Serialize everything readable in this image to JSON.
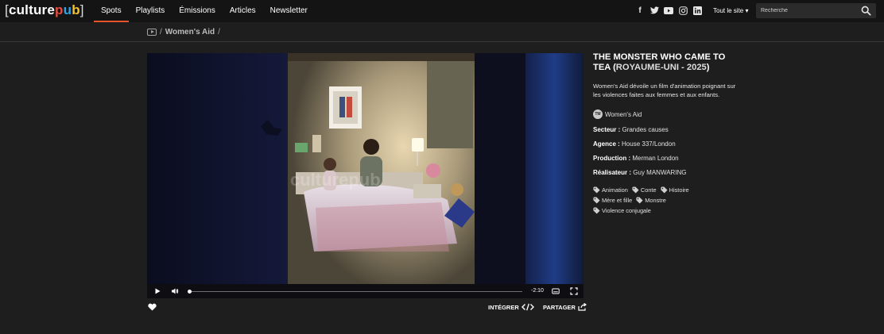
{
  "nav": {
    "logo": {
      "open": "[",
      "culture": "culture",
      "pub_p": "p",
      "pub_u": "u",
      "pub_b": "b",
      "close": "]"
    },
    "items": [
      {
        "label": "Spots",
        "active": true
      },
      {
        "label": "Playlists"
      },
      {
        "label": "Émissions"
      },
      {
        "label": "Articles"
      },
      {
        "label": "Newsletter"
      }
    ],
    "social_icons": [
      "facebook-icon",
      "twitter-icon",
      "youtube-icon",
      "instagram-icon",
      "linkedin-icon"
    ],
    "tout_le_site": "Tout le site ▾",
    "search_placeholder": "Recherche",
    "accent_color": "#e8542a"
  },
  "breadcrumb": {
    "sep1": "/",
    "current": "Women's Aid",
    "sep2": "/"
  },
  "video": {
    "watermark": "culturepub",
    "time": "-2:10",
    "progress": 0.0,
    "controls": [
      "play-icon",
      "volume-icon",
      "subtitles-icon",
      "fullscreen-icon"
    ]
  },
  "actions": {
    "integrer": "INTÉGRER",
    "partager": "PARTAGER"
  },
  "info": {
    "title_main": "THE MONSTER WHO CAME TO TEA (",
    "title_country": "ROYAUME-UNI - 2025",
    "title_close": ")",
    "description": "Women's Aid dévoile un film d'animation poignant sur les violences faites aux femmes et aux enfants.",
    "advertiser": "Women's Aid",
    "advertiser_logo": "TM",
    "secteur_label": "Secteur :",
    "secteur": "Grandes causes",
    "agence_label": "Agence :",
    "agence": "House 337/London",
    "production_label": "Production :",
    "production": "Merman London",
    "realisateur_label": "Réalisateur :",
    "realisateur": "Guy MANWARING",
    "tags": [
      "Animation",
      "Conte",
      "Histoire",
      "Mère et fille",
      "Monstre",
      "Violence conjugale"
    ]
  }
}
